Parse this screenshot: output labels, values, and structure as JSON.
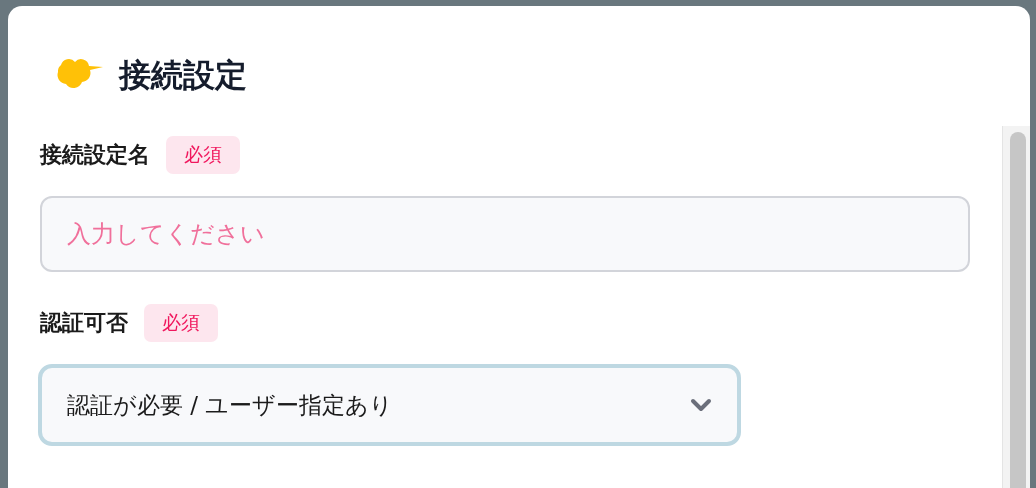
{
  "dialog": {
    "title": "接続設定"
  },
  "fields": [
    {
      "kind": "text",
      "label": "接続設定名",
      "badge": "必須",
      "placeholder": "入力してください"
    },
    {
      "kind": "select",
      "label": "認証可否",
      "badge": "必須",
      "value": "認証が必要 / ユーザー指定あり",
      "focused": true
    }
  ]
}
